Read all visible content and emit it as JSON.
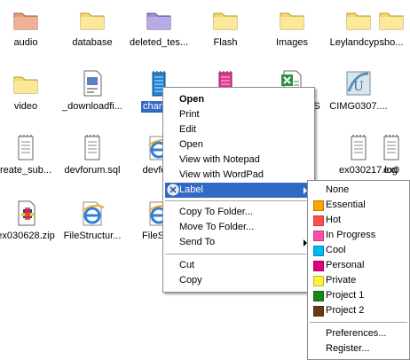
{
  "desktop": {
    "files": [
      {
        "name": "audio",
        "icon": "folder-icon",
        "color": "#e49a7c"
      },
      {
        "name": "database",
        "icon": "folder-icon",
        "color": "#f3d86b"
      },
      {
        "name": "deleted_tes...",
        "icon": "folder-icon",
        "color": "#9d8fd6"
      },
      {
        "name": "Flash",
        "icon": "folder-icon",
        "color": "#f3d86b"
      },
      {
        "name": "Images",
        "icon": "folder-icon",
        "color": "#f3d86b"
      },
      {
        "name": "Leylandcyp...",
        "icon": "folder-icon",
        "color": "#f3d86b"
      },
      {
        "name": "sho...",
        "icon": "folder-icon",
        "color": "#f3d86b"
      },
      {
        "name": "video",
        "icon": "folder-icon",
        "color": "#f3d86b"
      },
      {
        "name": "_downloadfi...",
        "icon": "document-icon",
        "color": "#c9c9c9"
      },
      {
        "name": "change",
        "icon": "notepad-icon",
        "color": "#1e83d4"
      },
      {
        "name": "",
        "icon": "notepad-icon",
        "color": "#e0388e"
      },
      {
        "name": "LS",
        "icon": "excel-icon",
        "color": "#2f8d3f"
      },
      {
        "name": "CIMG0307....",
        "icon": "image-icon",
        "color": "#7aa7c7"
      },
      {
        "name": "reate_sub...",
        "icon": "text-file-icon",
        "color": "#c9c9c9"
      },
      {
        "name": "devforum.sql",
        "icon": "text-file-icon",
        "color": "#c9c9c9"
      },
      {
        "name": "devforu",
        "icon": "ie-icon",
        "color": "#2f7fd6"
      },
      {
        "name": "ex030217.log",
        "icon": "text-file-icon",
        "color": "#c9c9c9"
      },
      {
        "name": "ex0",
        "icon": "text-file-icon",
        "color": "#c9c9c9"
      },
      {
        "name": "ex030628.zip",
        "icon": "zip-icon",
        "color": "#c9c9c9"
      },
      {
        "name": "FileStructur...",
        "icon": "ie-icon",
        "color": "#2f7fd6"
      },
      {
        "name": "FileStru",
        "icon": "ie-icon",
        "color": "#2f7fd6"
      }
    ]
  },
  "context_menu": {
    "items": [
      {
        "label": "Open",
        "bold": true
      },
      {
        "label": "Print"
      },
      {
        "label": "Edit"
      },
      {
        "label": "Open"
      },
      {
        "label": "View with Notepad"
      },
      {
        "label": "View with WordPad"
      },
      {
        "label": "Label",
        "icon": "label-icon",
        "submenu": true,
        "active": true
      },
      {
        "sep": true
      },
      {
        "label": "Copy To Folder..."
      },
      {
        "label": "Move To Folder..."
      },
      {
        "label": "Send To",
        "submenu": true
      },
      {
        "sep": true
      },
      {
        "label": "Cut"
      },
      {
        "label": "Copy"
      }
    ]
  },
  "label_submenu": {
    "items": [
      {
        "label": "None"
      },
      {
        "label": "Essential",
        "color": "#ffa500"
      },
      {
        "label": "Hot",
        "color": "#ff5050"
      },
      {
        "label": "In Progress",
        "color": "#ff4fa6"
      },
      {
        "label": "Cool",
        "color": "#00b7f0"
      },
      {
        "label": "Personal",
        "color": "#e0007a"
      },
      {
        "label": "Private",
        "color": "#fff03c"
      },
      {
        "label": "Project 1",
        "color": "#168a16"
      },
      {
        "label": "Project 2",
        "color": "#6b3a12"
      },
      {
        "sep": true
      },
      {
        "label": "Preferences..."
      },
      {
        "label": "Register..."
      }
    ]
  }
}
